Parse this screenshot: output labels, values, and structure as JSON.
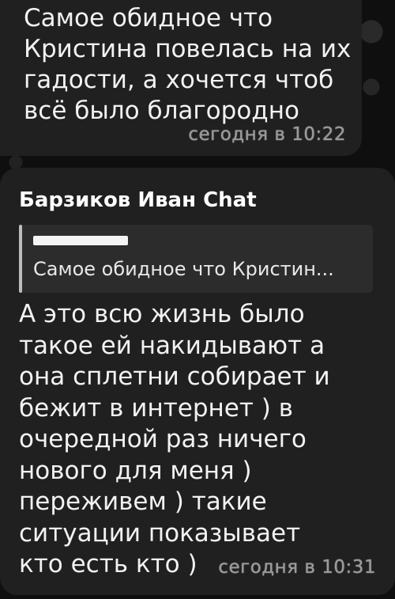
{
  "messages": [
    {
      "text": "Самое обидное что Кристина повелась на их гадости, а хочется чтоб всё было благородно",
      "time": "сегодня в 10:22"
    },
    {
      "sender": "Барзиков Иван Chat",
      "reply_preview": "Самое обидное что Кристин...",
      "text": "А это всю жизнь было такое ей накидывают а она сплетни собирает и бежит в интернет ) в очередной раз ничего нового для меня ) переживем ) такие ситуации показывает кто есть кто )",
      "time": "сегодня в 10:31"
    }
  ]
}
